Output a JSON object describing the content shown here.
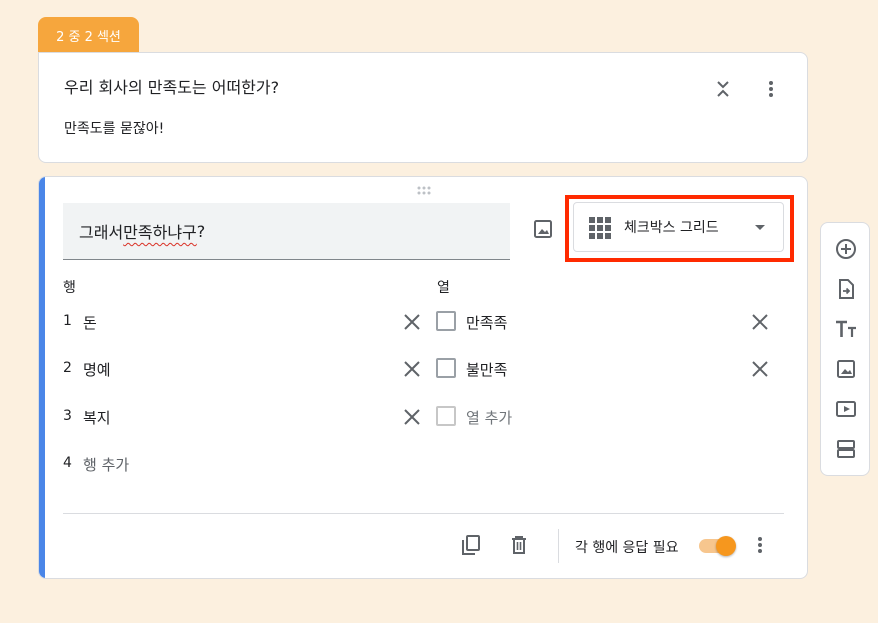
{
  "section_tab": "2 중 2 섹션",
  "section": {
    "title": "우리 회사의 만족도는 어떠한가?",
    "description": "만족도를 묻잖아!"
  },
  "question": {
    "title_a": "그래서 ",
    "title_b": "만족하냐구",
    "title_c": "?",
    "type_label": "체크박스 그리드",
    "rows_header": "행",
    "cols_header": "열",
    "rows": [
      {
        "num": "1",
        "label": "돈"
      },
      {
        "num": "2",
        "label": "명예"
      },
      {
        "num": "3",
        "label": "복지"
      }
    ],
    "add_row": {
      "num": "4",
      "label": "행 추가"
    },
    "columns": [
      {
        "label": "만족족"
      },
      {
        "label": "불만족"
      }
    ],
    "add_column": "열 추가",
    "required_label": "각 행에 응답 필요",
    "required_on": true
  },
  "colors": {
    "accent": "#f6a63d",
    "question_accent": "#4a86e8",
    "highlight": "#ff2a00",
    "background": "#fcf0df"
  },
  "toolbar_icons": [
    "add-question-icon",
    "import-question-icon",
    "title-text-icon",
    "add-image-icon",
    "add-video-icon",
    "add-section-icon"
  ]
}
